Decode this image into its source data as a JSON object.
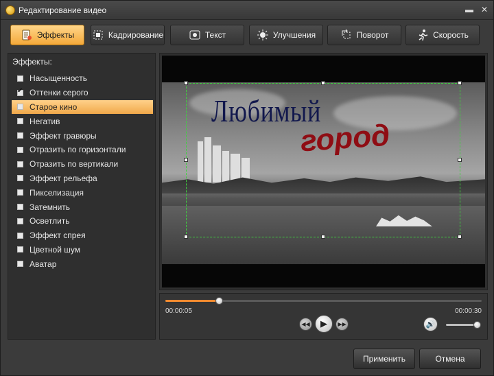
{
  "window": {
    "title": "Редактирование видео",
    "minimize": "▬",
    "close": "✕"
  },
  "tabs": [
    {
      "label": "Эффекты",
      "icon": "effects-icon",
      "active": true
    },
    {
      "label": "Кадрирование",
      "icon": "crop-icon",
      "active": false
    },
    {
      "label": "Текст",
      "icon": "text-icon",
      "active": false
    },
    {
      "label": "Улучшения",
      "icon": "enhance-icon",
      "active": false
    },
    {
      "label": "Поворот",
      "icon": "rotate-icon",
      "active": false
    },
    {
      "label": "Скорость",
      "icon": "speed-icon",
      "active": false
    }
  ],
  "effects_panel": {
    "heading": "Эффекты:",
    "items": [
      {
        "label": "Насыщенность",
        "checked": false,
        "selected": false
      },
      {
        "label": "Оттенки серого",
        "checked": true,
        "selected": false
      },
      {
        "label": "Старое кино",
        "checked": false,
        "selected": true
      },
      {
        "label": "Негатив",
        "checked": false,
        "selected": false
      },
      {
        "label": "Эффект гравюры",
        "checked": false,
        "selected": false
      },
      {
        "label": "Отразить по горизонтали",
        "checked": false,
        "selected": false
      },
      {
        "label": "Отразить по вертикали",
        "checked": false,
        "selected": false
      },
      {
        "label": "Эффект рельефа",
        "checked": false,
        "selected": false
      },
      {
        "label": "Пикселизация",
        "checked": false,
        "selected": false
      },
      {
        "label": "Затемнить",
        "checked": false,
        "selected": false
      },
      {
        "label": "Осветлить",
        "checked": false,
        "selected": false
      },
      {
        "label": "Эффект спрея",
        "checked": false,
        "selected": false
      },
      {
        "label": "Цветной шум",
        "checked": false,
        "selected": false
      },
      {
        "label": "Аватар",
        "checked": false,
        "selected": false
      }
    ]
  },
  "preview": {
    "overlay_title": "Любимый",
    "overlay_subtitle": "город"
  },
  "player": {
    "time_current": "00:00:05",
    "time_total": "00:00:30",
    "progress": 0.17,
    "volume": 0.9
  },
  "colors": {
    "accent": "#f4a93a",
    "selection_border": "#3fd13f",
    "progress_fill": "#f18a2f"
  },
  "buttons": {
    "apply": "Применить",
    "cancel": "Отмена"
  }
}
